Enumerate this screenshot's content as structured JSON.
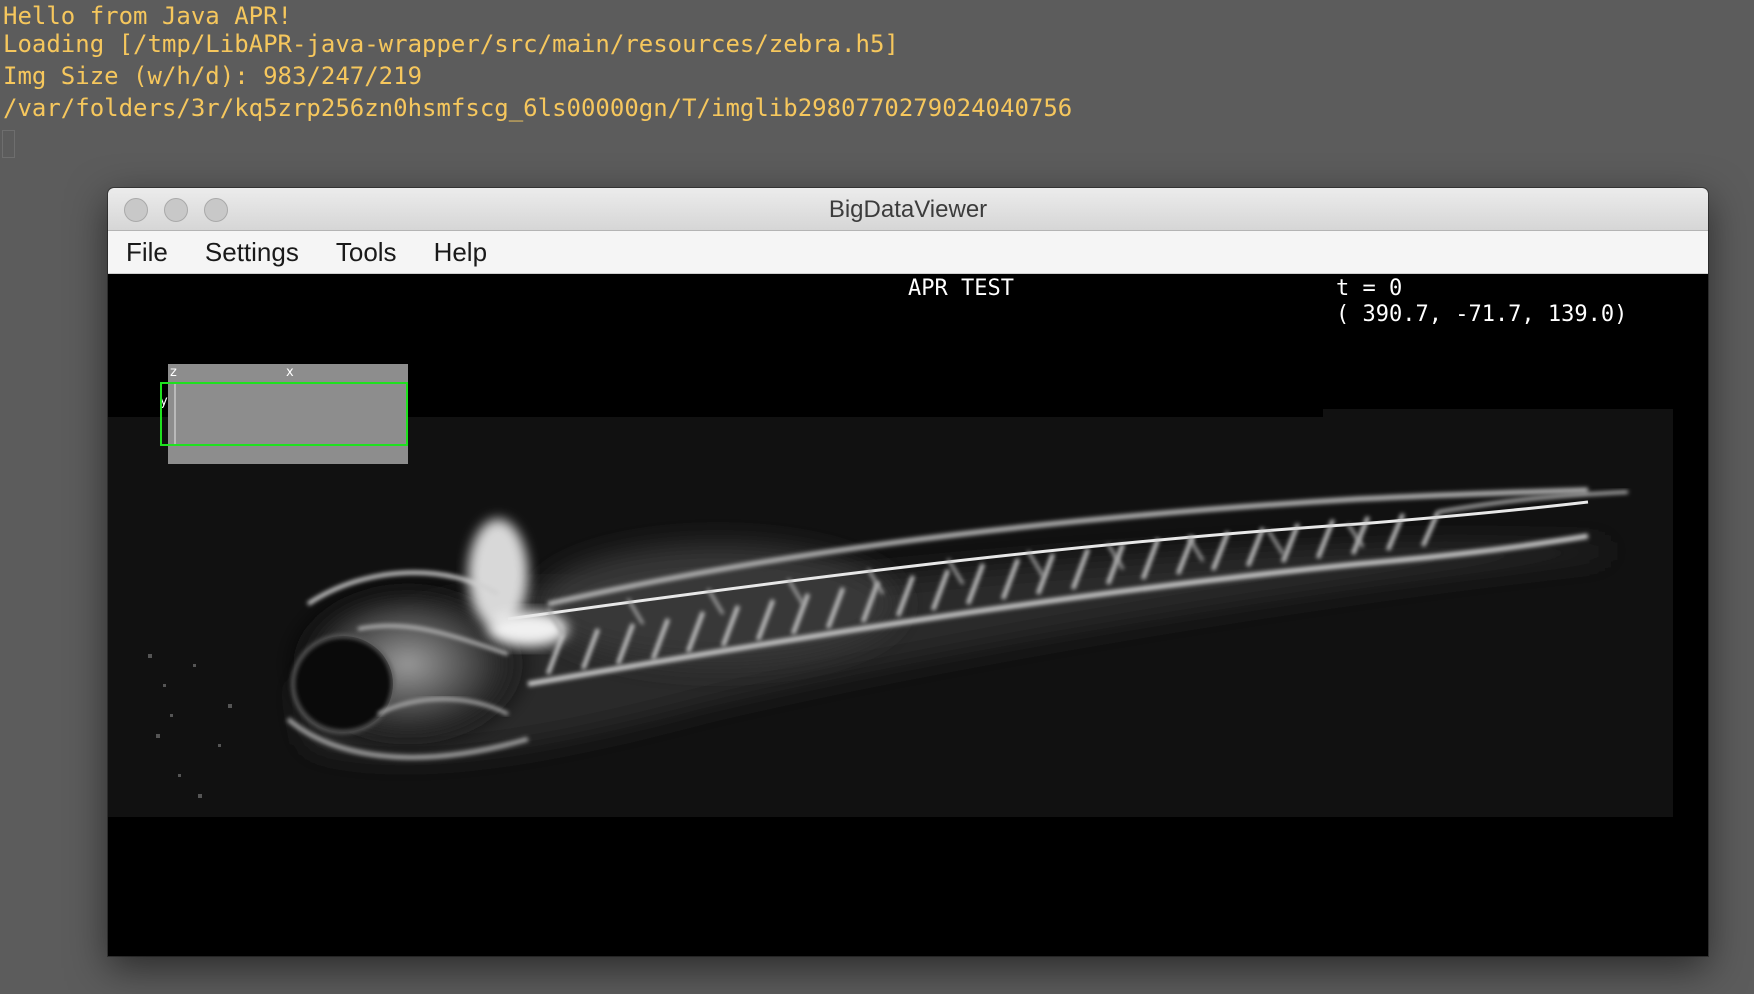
{
  "terminal": {
    "lines": [
      "Hello from Java APR!",
      "Loading [/tmp/LibAPR-java-wrapper/src/main/resources/zebra.h5]",
      "Img Size (w/h/d): 983/247/219",
      "/var/folders/3r/kq5zrp256zn0hsmfscg_6ls00000gn/T/imglib2980770279024040756"
    ]
  },
  "window": {
    "title": "BigDataViewer",
    "menu": [
      "File",
      "Settings",
      "Tools",
      "Help"
    ]
  },
  "viewer": {
    "source_name": "APR TEST",
    "timepoint": "t = 0",
    "coordinates": "( 390.7, -71.7, 139.0)",
    "box_axes": {
      "z": "z",
      "x": "x",
      "y": "y"
    }
  },
  "colors": {
    "terminal_text": "#f6c75d",
    "box_outline": "#1fe11f"
  }
}
